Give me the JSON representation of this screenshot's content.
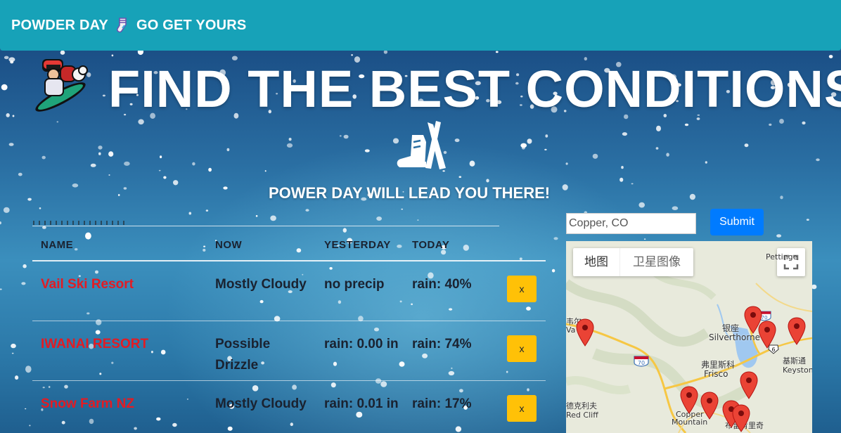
{
  "navbar": {
    "brand": "POWDER DAY",
    "brand_suffix": "GO GET YOURS",
    "brand_icon": "sock-icon"
  },
  "hero": {
    "title": "FIND THE BEST CONDITIONS",
    "subtitle": "POWER DAY WILL LEAD YOU THERE!",
    "left_icon": "snowboarder-icon",
    "center_icon": "ski-boot-icon"
  },
  "table": {
    "headers": [
      "NAME",
      "NOW",
      "YESTERDAY",
      "TODAY"
    ],
    "rows": [
      {
        "name": "Vail Ski Resort",
        "now": "Mostly Cloudy",
        "yesterday": "no precip",
        "today": "rain: 40%",
        "remove": "x"
      },
      {
        "name": "IWANAI RESORT",
        "now": "Possible Drizzle",
        "yesterday": "rain: 0.00 in",
        "today": "rain: 74%",
        "remove": "x"
      },
      {
        "name": "Snow Farm NZ",
        "now": "Mostly Cloudy",
        "yesterday": "rain: 0.01 in",
        "today": "rain: 17%",
        "remove": "x"
      }
    ]
  },
  "search": {
    "value": "Copper, CO",
    "submit_label": "Submit"
  },
  "map": {
    "tab_map": "地图",
    "tab_satellite": "卫星图像",
    "labels": {
      "pettinger": "Pettinge",
      "silverthorne_cn": "银座",
      "silverthorne": "Silverthorne",
      "frisco_cn": "弗里斯科",
      "frisco": "Frisco",
      "keystone_cn": "基斯通",
      "keystone": "Keystone",
      "vail_cn": "韦尔",
      "vail": "Va",
      "redcliff_cn": "德克利夫",
      "redcliff": "Red Cliff",
      "copper": "Copper",
      "mountain": "Mountain",
      "breck_cn": "布雷肯里奇",
      "hwy70a": "70",
      "hwy70b": "70",
      "hwy6": "6"
    },
    "colors": {
      "pin": "#ea4335",
      "road": "#f6c744",
      "water": "#a0c8f0"
    }
  },
  "colors": {
    "navbar": "#17a2b8",
    "name_link": "#e31b23",
    "remove_button": "#ffc107",
    "submit_button": "#007bff"
  }
}
